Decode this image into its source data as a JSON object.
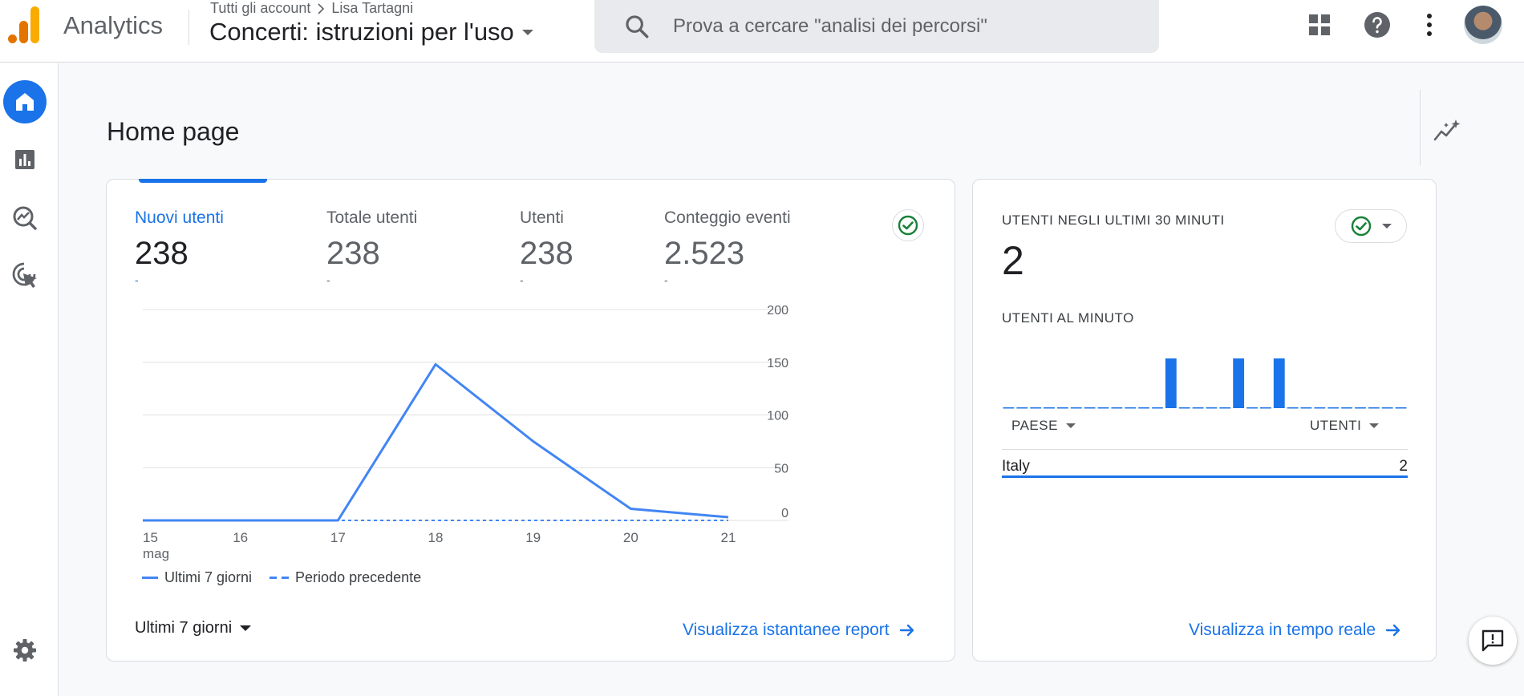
{
  "app": {
    "product_name": "Analytics",
    "breadcrumb": {
      "root": "Tutti gli account",
      "account": "Lisa Tartagni"
    },
    "property_name": "Concerti: istruzioni per l'uso",
    "search": {
      "placeholder": "Prova a cercare \"analisi dei percorsi\""
    },
    "colors": {
      "brand": "#1a73e8",
      "logo_orange": "#f9ab00",
      "logo_dark": "#e37400"
    }
  },
  "nav": {
    "items": [
      {
        "name": "home",
        "icon": "home-icon",
        "active": true
      },
      {
        "name": "reports",
        "icon": "bar-chart-icon",
        "active": false
      },
      {
        "name": "explore",
        "icon": "explore-icon",
        "active": false
      },
      {
        "name": "advertising",
        "icon": "target-cursor-icon",
        "active": false
      }
    ],
    "settings_icon": "gear-icon"
  },
  "page": {
    "title": "Home page"
  },
  "overview": {
    "metrics": [
      {
        "label": "Nuovi utenti",
        "value": "238",
        "delta": "-",
        "active": true
      },
      {
        "label": "Totale utenti",
        "value": "238",
        "delta": "-",
        "active": false
      },
      {
        "label": "Utenti",
        "value": "238",
        "delta": "-",
        "active": false
      },
      {
        "label": "Conteggio eventi",
        "value": "2.523",
        "delta": "-",
        "active": false
      }
    ],
    "range_label": "Ultimi 7 giorni",
    "link_label": "Visualizza istantanee report"
  },
  "chart_data": {
    "type": "line",
    "x": [
      "15",
      "16",
      "17",
      "18",
      "19",
      "20",
      "21"
    ],
    "x_sublabel": "mag",
    "series": [
      {
        "name": "Ultimi 7 giorni",
        "values": [
          0,
          0,
          0,
          148,
          75,
          11,
          3
        ],
        "style": "solid"
      },
      {
        "name": "Periodo precedente",
        "values": [
          0,
          0,
          0,
          0,
          0,
          0,
          0
        ],
        "style": "dashed"
      }
    ],
    "yticks": [
      0,
      50,
      100,
      150,
      200
    ],
    "ylim": [
      0,
      200
    ],
    "y_axis_side": "right",
    "grid": true,
    "legend": "bottom-left",
    "color": "#4285f4"
  },
  "realtime": {
    "title": "UTENTI NEGLI ULTIMI 30 MINUTI",
    "value": "2",
    "per_minute_title": "UTENTI AL MINUTO",
    "per_minute_values": [
      0,
      0,
      0,
      0,
      0,
      0,
      0,
      0,
      0,
      0,
      0,
      0,
      1,
      0,
      0,
      0,
      0,
      1,
      0,
      0,
      1,
      0,
      0,
      0,
      0,
      0,
      0,
      0,
      0,
      0
    ],
    "table": {
      "col_country": "PAESE",
      "col_users": "UTENTI",
      "rows": [
        {
          "country": "Italy",
          "users": "2"
        }
      ]
    },
    "link_label": "Visualizza in tempo reale"
  }
}
